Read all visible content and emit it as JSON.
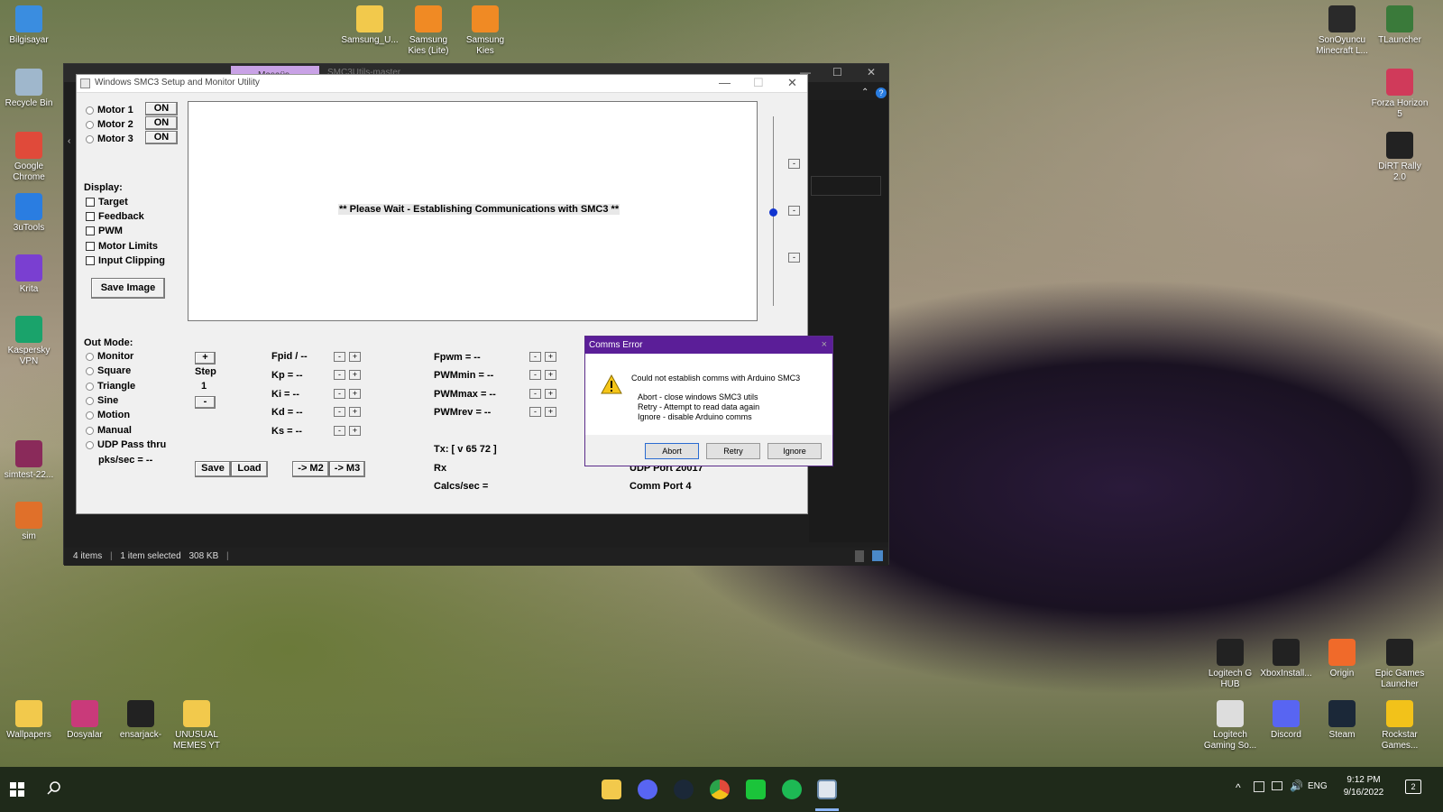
{
  "desktop": {
    "icons_left": [
      {
        "label": "Bilgisayar",
        "color": "#3a8de0"
      },
      {
        "label": "Recycle Bin",
        "color": "#9fb7cc"
      },
      {
        "label": "Google Chrome",
        "color": "#e04a3a"
      },
      {
        "label": "3uTools",
        "color": "#2a7de1"
      },
      {
        "label": "Krita",
        "color": "#7a3fd1"
      },
      {
        "label": "Kaspersky VPN",
        "color": "#1aa36b"
      },
      {
        "label": "simtest-22...",
        "color": "#8a2a5a"
      },
      {
        "label": "sim",
        "color": "#e0702a"
      }
    ],
    "icons_top": [
      {
        "label": "Samsung_U...",
        "color": "#f2c94c"
      },
      {
        "label": "Samsung Kies (Lite)",
        "color": "#f08a24"
      },
      {
        "label": "Samsung Kies",
        "color": "#f08a24"
      }
    ],
    "icons_right": [
      {
        "label": "SonOyuncu Minecraft L...",
        "color": "#2a2a2a"
      },
      {
        "label": "TLauncher",
        "color": "#3a7a3a"
      },
      {
        "label": "Forza Horizon 5",
        "color": "#d03a5a"
      },
      {
        "label": "DiRT Rally 2.0",
        "color": "#222222"
      }
    ],
    "icons_bottom_left": [
      {
        "label": "Wallpapers",
        "color": "#f2c94c"
      },
      {
        "label": "Dosyalar",
        "color": "#c93a7a"
      },
      {
        "label": "ensarjack-",
        "color": "#222222"
      },
      {
        "label": "UNUSUAL MEMES YT",
        "color": "#f2c94c"
      }
    ],
    "icons_bottom_right_row1": [
      {
        "label": "Logitech G HUB",
        "color": "#222222"
      },
      {
        "label": "XboxInstall...",
        "color": "#222222"
      },
      {
        "label": "Origin",
        "color": "#f06a2a"
      },
      {
        "label": "Epic Games Launcher",
        "color": "#222222"
      }
    ],
    "icons_bottom_right_row2": [
      {
        "label": "Logitech Gaming So...",
        "color": "#dddddd"
      },
      {
        "label": "Discord",
        "color": "#5865f2"
      },
      {
        "label": "Steam",
        "color": "#1b2838"
      },
      {
        "label": "Rockstar Games...",
        "color": "#f2c21a"
      }
    ]
  },
  "explorer": {
    "tab_label": "Masaüs",
    "tab2_label": "SMC3Utils-master",
    "status": {
      "items": "4 items",
      "selected": "1 item selected",
      "size": "308 KB"
    }
  },
  "smc": {
    "title": "Windows SMC3 Setup and Monitor Utility",
    "motors": [
      {
        "label": "Motor 1",
        "state": "ON"
      },
      {
        "label": "Motor 2",
        "state": "ON"
      },
      {
        "label": "Motor 3",
        "state": "ON"
      }
    ],
    "display_heading": "Display:",
    "display_options": [
      "Target",
      "Feedback",
      "PWM",
      "Motor Limits",
      "Input Clipping"
    ],
    "save_image": "Save Image",
    "wait_message": "** Please Wait - Establishing Communications with SMC3 **",
    "slider_minus": "-",
    "out_mode_heading": "Out Mode:",
    "out_modes": [
      "Monitor",
      "Square",
      "Triangle",
      "Sine",
      "Motion",
      "Manual",
      "UDP Pass thru"
    ],
    "pks_sec": "pks/sec = --",
    "step_plus": "+",
    "step_label": "Step",
    "step_value": "1",
    "step_minus": "-",
    "pid_params": [
      "Fpid / --",
      "Kp = --",
      "Ki = --",
      "Kd = --",
      "Ks = --"
    ],
    "pwm_params": [
      "Fpwm = --",
      "PWMmin = --",
      "PWMmax = --",
      "PWMrev = --"
    ],
    "minus": "-",
    "plus": "+",
    "save_btn": "Save",
    "load_btn": "Load",
    "m2_btn": "-> M2",
    "m3_btn": "-> M3",
    "tx": "Tx: [ v 65 72 ]",
    "rx": "Rx",
    "calcs": "Calcs/sec =",
    "udp_port": "UDP Port 20017",
    "comm_port": "Comm Port 4"
  },
  "dialog": {
    "title": "Comms Error",
    "close": "×",
    "message": "Could not establish comms with Arduino SMC3",
    "line1": "Abort - close windows SMC3 utils",
    "line2": "Retry - Attempt to read data again",
    "line3": "Ignore - disable Arduino comms",
    "abort": "Abort",
    "retry": "Retry",
    "ignore": "Ignore"
  },
  "taskbar": {
    "lang": "ENG",
    "time": "9:12 PM",
    "date": "9/16/2022",
    "notif_count": "2"
  }
}
